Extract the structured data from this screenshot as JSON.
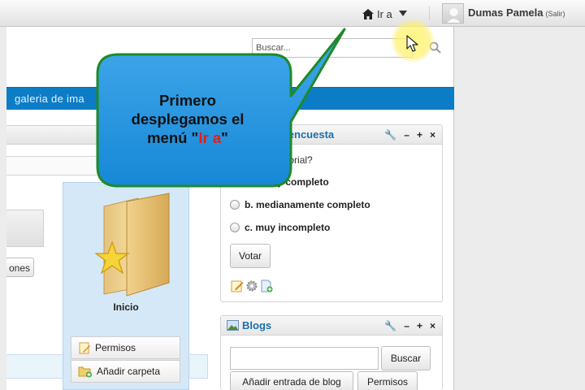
{
  "topbar": {
    "goto_label": "Ir a",
    "user_name": "Dumas Pamela",
    "signout_label": "(Salir)"
  },
  "search": {
    "placeholder": "Buscar..."
  },
  "nav": {
    "item_label": "galeria de ima"
  },
  "left": {
    "options_button": "ones"
  },
  "folder": {
    "name": "Inicio"
  },
  "folder_actions": [
    {
      "label": "Permisos",
      "icon": "permissions-icon"
    },
    {
      "label": "Añadir carpeta",
      "icon": "add-folder-icon"
    }
  ],
  "poll": {
    "title": "de encuesta",
    "question": "pleto el tutorial?",
    "choices": [
      {
        "label": "uy completo"
      },
      {
        "label": "b. medianamente completo"
      },
      {
        "label": "c. muy incompleto"
      }
    ],
    "vote_label": "Votar"
  },
  "blogs": {
    "title": "Blogs",
    "search_label": "Buscar",
    "add_entry_label": "Añadir entrada de blog",
    "permissions_label": "Permisos"
  },
  "callout": {
    "line1": "Primero",
    "line2": "desplegamos el",
    "line3_prefix": "menú \"",
    "line3_highlight": "Ir a",
    "line3_suffix": "\"",
    "highlight_color": "#e41c1c",
    "fill_color": "#1f8fdb",
    "border_color": "#1f8a2a"
  },
  "colors": {
    "navbar": "#0c7cc6",
    "portlet_title": "#1b6fae",
    "folder_panel": "#d5e8f7"
  }
}
